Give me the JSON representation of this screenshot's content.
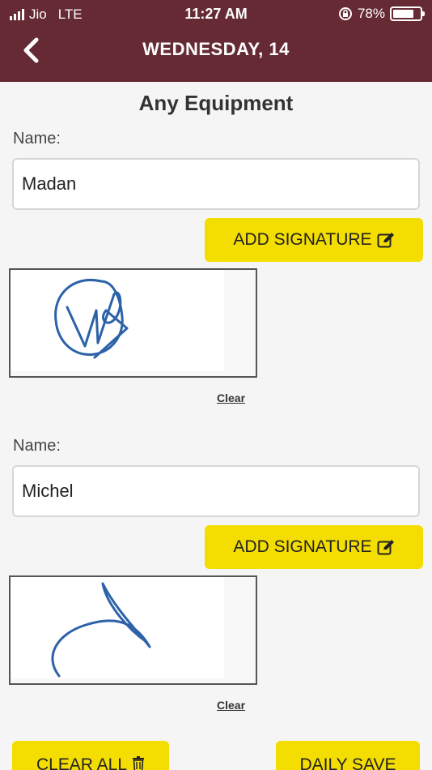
{
  "status_bar": {
    "carrier": "Jio",
    "network": "LTE",
    "time": "11:27 AM",
    "battery_percent": "78%",
    "battery_level": 0.78
  },
  "header": {
    "title": "WEDNESDAY,  14",
    "back_icon": "chevron-left-icon",
    "color": "#652a33"
  },
  "page_title": "Any Equipment",
  "entries": [
    {
      "name_label": "Name:",
      "name_value": "Madan",
      "add_signature_label": "ADD SIGNATURE",
      "clear_label": "Clear"
    },
    {
      "name_label": "Name:",
      "name_value": "Michel",
      "add_signature_label": "ADD SIGNATURE",
      "clear_label": "Clear"
    }
  ],
  "footer": {
    "clear_all_label": "CLEAR ALL",
    "daily_save_label": "DAILY SAVE"
  },
  "colors": {
    "accent_yellow": "#f4dd00",
    "signature_ink": "#2d62a8"
  }
}
